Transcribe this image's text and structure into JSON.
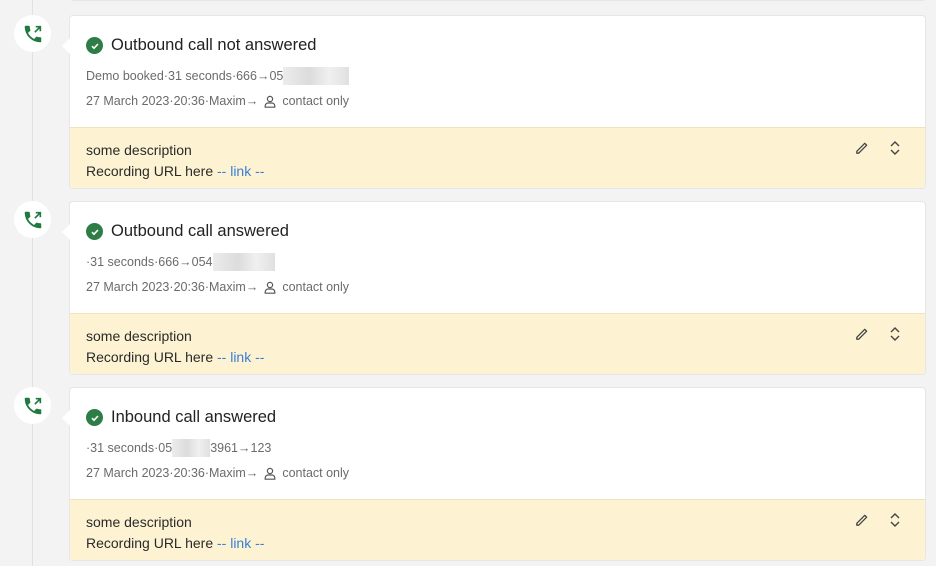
{
  "colors": {
    "success": "#2e7d46",
    "link": "#3a7fd6",
    "note_bg": "#fdf3d3",
    "page_bg": "#f3f3f3"
  },
  "entries": [
    {
      "icon": "phone-outgoing-icon",
      "status_icon": "check-circle-icon",
      "title": "Outbound call not answered",
      "meta_prefix": "Demo booked",
      "duration": "31 seconds",
      "from": "666",
      "to": "05",
      "to_redacted": true,
      "date": "27 March 2023",
      "time": "20:36",
      "user": "Maxim",
      "target": "contact only",
      "note_description": "some description",
      "note_recording_label": "Recording URL here",
      "note_link": "-- link --"
    },
    {
      "icon": "phone-outgoing-icon",
      "status_icon": "check-circle-icon",
      "title": "Outbound call answered",
      "meta_prefix": "",
      "duration": "31 seconds",
      "from": "666",
      "to": "054",
      "to_redacted": true,
      "date": "27 March 2023",
      "time": "20:36",
      "user": "Maxim",
      "target": "contact only",
      "note_description": "some description",
      "note_recording_label": "Recording URL here",
      "note_link": "-- link --"
    },
    {
      "icon": "phone-outgoing-icon",
      "status_icon": "check-circle-icon",
      "title": "Inbound call answered",
      "meta_prefix": "",
      "duration": "31 seconds",
      "from": "05",
      "from_suffix": "3961",
      "from_redacted": true,
      "to": "123",
      "date": "27 March 2023",
      "time": "20:36",
      "user": "Maxim",
      "target": "contact only",
      "note_description": "some description",
      "note_recording_label": "Recording URL here",
      "note_link": "-- link --"
    }
  ],
  "separators": {
    "dot": " · ",
    "arrow": " → "
  }
}
